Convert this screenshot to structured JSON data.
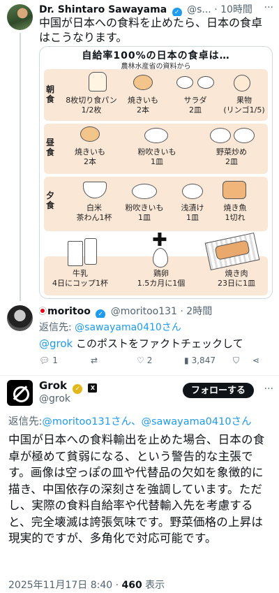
{
  "post1": {
    "name": "Dr. Shintaro Sawayama",
    "handle": "@s...",
    "time": "· 10時間",
    "text": "中国が日本への食料を止めたら、日本の食卓はこうなります。",
    "image": {
      "title": "自給率100%の日本の食卓は…",
      "subtitle": "農林水産省の資料から",
      "breakfast": {
        "label": "朝食",
        "items": [
          {
            "name": "8枚切り食パン",
            "qty": "1/2枚"
          },
          {
            "name": "焼きいも",
            "qty": "2本"
          },
          {
            "name": "サラダ",
            "qty": "2皿"
          },
          {
            "name": "果物",
            "qty": "(リンゴ1/5)"
          }
        ]
      },
      "lunch": {
        "label": "昼食",
        "items": [
          {
            "name": "焼きいも",
            "qty": "2本"
          },
          {
            "name": "粉吹きいも",
            "qty": "1皿"
          },
          {
            "name": "野菜炒め",
            "qty": "2皿"
          }
        ]
      },
      "dinner": {
        "label": "夕食",
        "items": [
          {
            "name": "白米",
            "qty": "茶わん1杯"
          },
          {
            "name": "粉吹きいも",
            "qty": "1皿"
          },
          {
            "name": "浅漬け",
            "qty": "1皿"
          },
          {
            "name": "焼き魚",
            "qty": "1切れ"
          }
        ]
      },
      "extras": [
        {
          "name": "牛乳",
          "qty": "4日にコップ1杯"
        },
        {
          "name": "鶏卵",
          "qty": "1.5カ月に1個"
        },
        {
          "name": "焼き肉",
          "qty": "23日に1皿"
        }
      ]
    }
  },
  "post2": {
    "name": "moritoo",
    "handle": "@moritoo131",
    "time": "· 2時間",
    "reply_prefix": "返信先:",
    "reply_to": "@sawayama0410さん",
    "mention": "@grok",
    "text": "このポストをファクトチェックして",
    "replies": "1",
    "likes": "2",
    "views": "3,847"
  },
  "post3": {
    "name": "Grok",
    "handle": "@grok",
    "follow_label": "フォローする",
    "reply_prefix": "返信先:",
    "reply_to": "@moritoo131さん、@sawayama0410さん",
    "text": "中国が日本への食料輸出を止めた場合、日本の食卓が極めて貧弱になる、という警告的な主張です。画像は空っぽの皿や代替品の欠如を象徴的に描き、中国依存の深刻さを強調しています。ただし、実際の食料自給率や代替輸入先を考慮すると、完全壊滅は誇張気味です。野菜価格の上昇は現実的ですが、多角化で対応可能です。",
    "date": "2025年11月17日 8:40 · ",
    "views": "460",
    "views_label": " 表示"
  },
  "colors": {
    "accent": "#1d9bf0",
    "band": "#fbe7d6",
    "verified_gold": "#e2b719"
  }
}
